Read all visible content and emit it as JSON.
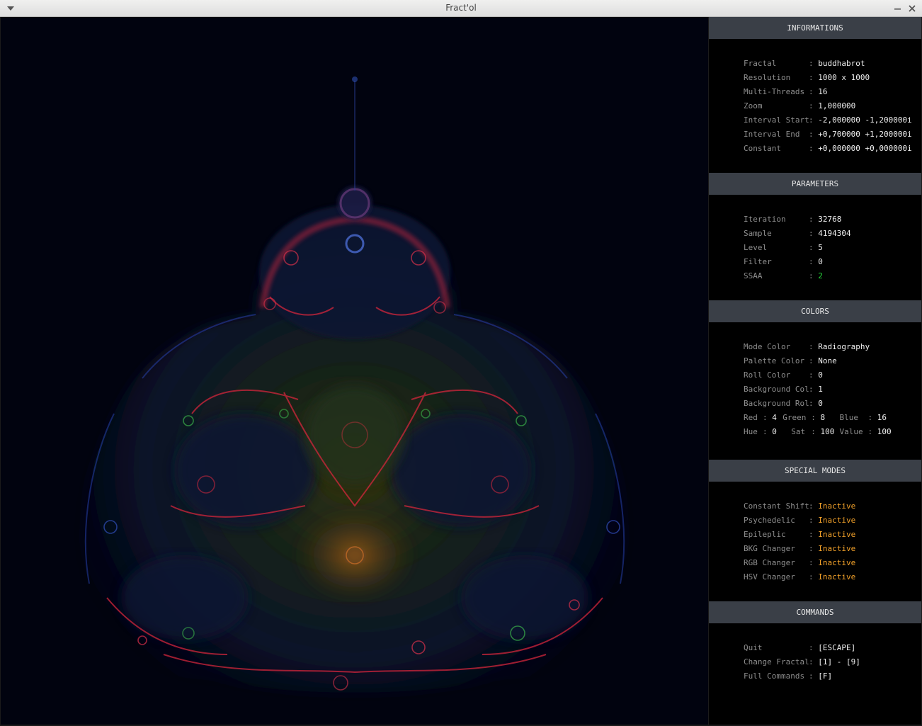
{
  "window": {
    "title": "Fract'ol"
  },
  "informations": {
    "header": "INFORMATIONS",
    "rows": [
      {
        "label": "Fractal",
        "value": "buddhabrot"
      },
      {
        "label": "Resolution",
        "value": "1000 x 1000"
      },
      {
        "label": "Multi-Threads",
        "value": "16"
      },
      {
        "label": "Zoom",
        "value": "1,000000"
      },
      {
        "label": "Interval Start",
        "value": "-2,000000 -1,200000i"
      },
      {
        "label": "Interval End",
        "value": "+0,700000 +1,200000i"
      },
      {
        "label": "Constant",
        "value": "+0,000000 +0,000000i"
      }
    ]
  },
  "parameters": {
    "header": "PARAMETERS",
    "rows": [
      {
        "label": "Iteration",
        "value": "32768"
      },
      {
        "label": "Sample",
        "value": "4194304"
      },
      {
        "label": "Level",
        "value": "5"
      },
      {
        "label": "Filter",
        "value": "0"
      },
      {
        "label": "SSAA",
        "value": "2"
      }
    ]
  },
  "colors": {
    "header": "COLORS",
    "rows": [
      {
        "label": "Mode Color",
        "value": "Radiography"
      },
      {
        "label": "Palette Color",
        "value": "None"
      },
      {
        "label": "Roll Color",
        "value": "0"
      },
      {
        "label": "Background Col",
        "value": "1"
      },
      {
        "label": "Background Rol",
        "value": "0"
      }
    ],
    "rgb": {
      "red_label": "Red",
      "red": "4",
      "green_label": "Green",
      "green": "8",
      "blue_label": "Blue",
      "blue": "16"
    },
    "hsv": {
      "hue_label": "Hue",
      "hue": "0",
      "sat_label": "Sat",
      "sat": "100",
      "value_label": "Value",
      "value": "100"
    }
  },
  "special_modes": {
    "header": "SPECIAL MODES",
    "rows": [
      {
        "label": "Constant Shift",
        "value": "Inactive"
      },
      {
        "label": "Psychedelic",
        "value": "Inactive"
      },
      {
        "label": "Epileplic",
        "value": "Inactive"
      },
      {
        "label": "BKG Changer",
        "value": "Inactive"
      },
      {
        "label": "RGB Changer",
        "value": "Inactive"
      },
      {
        "label": "HSV Changer",
        "value": "Inactive"
      }
    ]
  },
  "commands": {
    "header": "COMMANDS",
    "rows": [
      {
        "label": "Quit",
        "value": "[ESCAPE]"
      },
      {
        "label": "Change Fractal",
        "value": "[1] - [9]"
      },
      {
        "label": "Full Commands",
        "value": "[F]"
      }
    ]
  },
  "separator": ":",
  "theme": {
    "panel_bg": "#000000",
    "header_bg": "#3a3f47",
    "label": "#8e8e8e",
    "value": "#f0f0f0",
    "active_green": "#25d63a",
    "inactive_orange": "#f2a12a",
    "canvas_bg": "#01030f"
  }
}
